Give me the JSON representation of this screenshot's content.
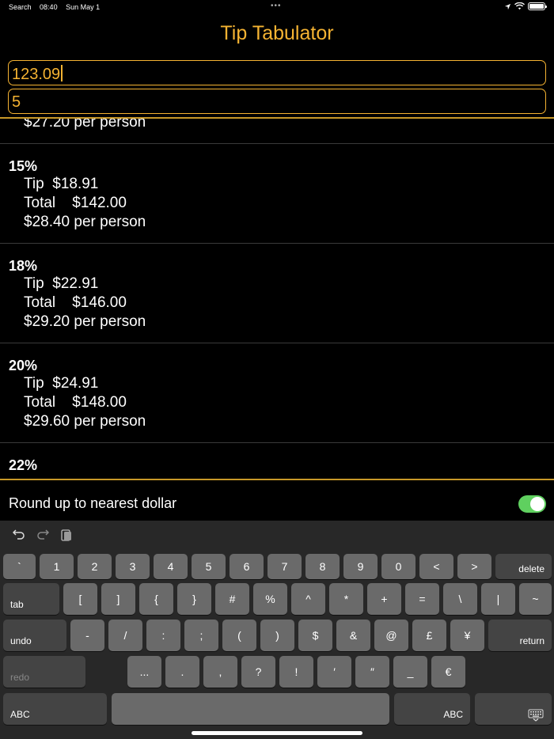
{
  "status_bar": {
    "back_app": "Search",
    "time": "08:40",
    "date": "Sun May 1",
    "dots": "•••",
    "location_icon": "location-arrow",
    "wifi_icon": "wifi",
    "battery_level": 1.0
  },
  "app": {
    "title": "Tip Tabulator",
    "accent_color": "#f5b332"
  },
  "inputs": {
    "bill_amount": "123.09",
    "people_count": "5"
  },
  "results": {
    "partial_top": "$27.20 per person",
    "sections": [
      {
        "percent": "15%",
        "tip_label": "Tip",
        "tip": "$18.91",
        "total_label": "Total",
        "total": "$142.00",
        "per_person": "$28.40 per person"
      },
      {
        "percent": "18%",
        "tip_label": "Tip",
        "tip": "$22.91",
        "total_label": "Total",
        "total": "$146.00",
        "per_person": "$29.20 per person"
      },
      {
        "percent": "20%",
        "tip_label": "Tip",
        "tip": "$24.91",
        "total_label": "Total",
        "total": "$148.00",
        "per_person": "$29.60 per person"
      },
      {
        "percent": "22%"
      }
    ]
  },
  "round_up": {
    "label": "Round up to nearest dollar",
    "on": true,
    "toggle_color": "#5fd05f"
  },
  "keyboard": {
    "toolbar": {
      "undo_icon": "undo-arrow",
      "redo_icon": "redo-arrow",
      "paste_icon": "clipboard"
    },
    "row1": [
      "`",
      "1",
      "2",
      "3",
      "4",
      "5",
      "6",
      "7",
      "8",
      "9",
      "0",
      "<",
      ">"
    ],
    "delete": "delete",
    "tab": "tab",
    "row2": [
      "[",
      "]",
      "{",
      "}",
      "#",
      "%",
      "^",
      "*",
      "+",
      "=",
      "\\",
      "|",
      "~"
    ],
    "undo": "undo",
    "row3": [
      "-",
      "/",
      ":",
      ";",
      "(",
      ")",
      "$",
      "&",
      "@",
      "£",
      "¥"
    ],
    "return": "return",
    "redo": "redo",
    "row4": [
      "...",
      ".",
      ",",
      "?",
      "!",
      "′",
      "″",
      "_",
      "€"
    ],
    "abc_left": "ABC",
    "abc_right": "ABC",
    "hide_icon": "keyboard-hide"
  }
}
